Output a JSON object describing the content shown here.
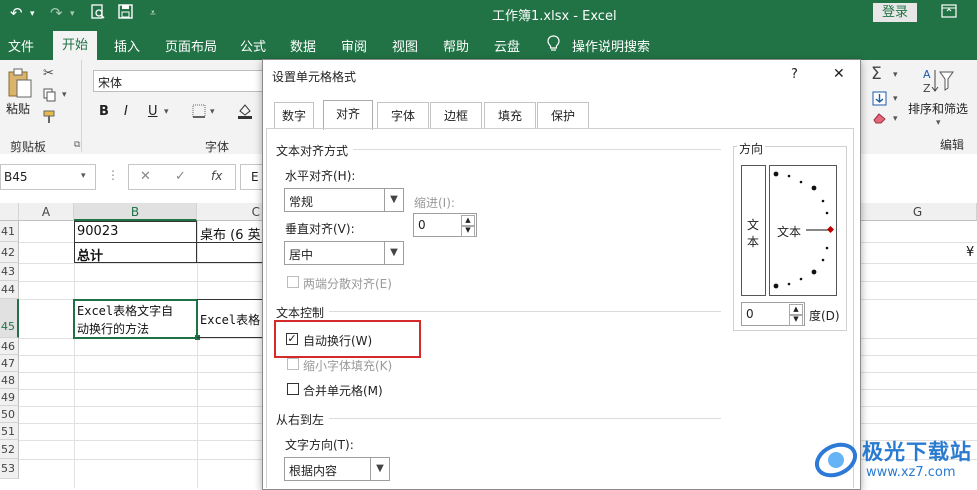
{
  "window": {
    "title": "工作簿1.xlsx  -  Excel",
    "login": "登录"
  },
  "ribbon_tabs": [
    "文件",
    "开始",
    "插入",
    "页面布局",
    "公式",
    "数据",
    "审阅",
    "视图",
    "帮助",
    "云盘",
    "操作说明搜索"
  ],
  "ribbon": {
    "paste": "粘贴",
    "clipboard": "剪贴板",
    "font_name": "宋体",
    "font_group": "字体",
    "bold": "B",
    "italic": "I",
    "underline": "U",
    "sort_filter": "排序和筛选",
    "edit_group": "编辑"
  },
  "formula_bar": {
    "name_box": "B45",
    "fx": "fx",
    "content": "E"
  },
  "columns": [
    "A",
    "B",
    "C",
    "G"
  ],
  "rows": [
    "41",
    "42",
    "43",
    "44",
    "45",
    "46",
    "47",
    "48",
    "49",
    "50",
    "51",
    "52",
    "53"
  ],
  "cells": {
    "b41": "90023",
    "c41": "桌布 (6 英",
    "b42": "总计",
    "b45_line1": "Excel表格文字自",
    "b45_line2": "动换行的方法",
    "c45": "Excel表格",
    "g42": "¥"
  },
  "dialog": {
    "title": "设置单元格格式",
    "help": "?",
    "close": "✕",
    "tabs": [
      "数字",
      "对齐",
      "字体",
      "边框",
      "填充",
      "保护"
    ],
    "active_tab": "对齐",
    "text_align_section": "文本对齐方式",
    "horizontal_label": "水平对齐(H):",
    "horizontal_value": "常规",
    "vertical_label": "垂直对齐(V):",
    "vertical_value": "居中",
    "indent_label": "缩进(I):",
    "indent_value": "0",
    "justify_distributed": "两端分散对齐(E)",
    "text_control_section": "文本控制",
    "wrap_text": "自动换行(W)",
    "wrap_checked": true,
    "shrink_to_fit": "缩小字体填充(K)",
    "merge_cells": "合并单元格(M)",
    "rtl_section": "从右到左",
    "text_direction_label": "文字方向(T):",
    "text_direction_value": "根据内容",
    "orientation_section": "方向",
    "vertical_text_1": "文",
    "vertical_text_2": "本",
    "orientation_text": "文本",
    "degree_value": "0",
    "degree_label": "度(D)"
  },
  "watermark": {
    "name": "极光下载站",
    "url": "www.xz7.com"
  },
  "colors": {
    "excel_green": "#217346",
    "highlight_red": "#d42a2a",
    "selected_green": "#1e7145",
    "orient_red": "#c00000"
  }
}
